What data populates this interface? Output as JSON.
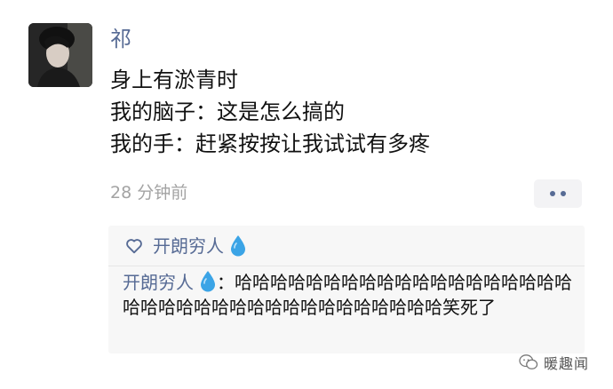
{
  "post": {
    "author": "祁",
    "lines": [
      "身上有淤青时",
      "我的脑子：这是怎么搞的",
      "我的手：赶紧按按让我试试有多疼"
    ],
    "time": "28 分钟前"
  },
  "likes": {
    "icon": "heart-outline-icon",
    "names": [
      "开朗穷人"
    ],
    "emoji": "water-drop-icon"
  },
  "comments": [
    {
      "author": "开朗穷人",
      "separator": "：",
      "text": "哈哈哈哈哈哈哈哈哈哈哈哈哈哈哈哈哈哈哈哈哈哈哈哈哈哈哈哈哈哈哈哈哈哈哈哈哈笑死了"
    }
  ],
  "watermark": {
    "text": "暖趣闻",
    "icon": "wechat-logo-icon"
  },
  "colors": {
    "link_blue": "#576b95",
    "text": "#111111",
    "muted": "#a3a3a3",
    "panel_bg": "#f7f7f7"
  }
}
